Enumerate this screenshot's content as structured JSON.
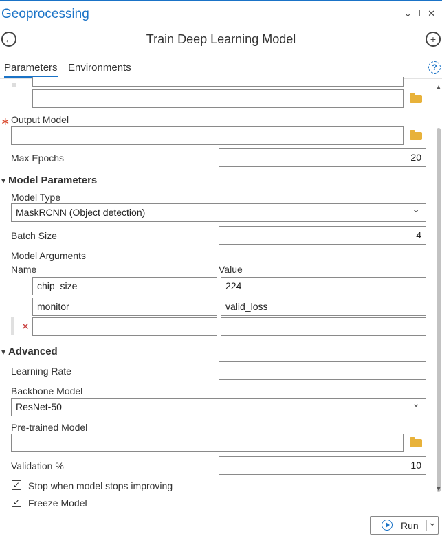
{
  "pane": {
    "title": "Geoprocessing",
    "header_icons": [
      "chevron-down-icon",
      "pin-icon",
      "close-icon"
    ],
    "accent_color": "#1a73c7"
  },
  "tool": {
    "title": "Train Deep Learning Model"
  },
  "tabs": [
    {
      "label": "Parameters",
      "active": true
    },
    {
      "label": "Environments",
      "active": false
    }
  ],
  "params": {
    "top_field_value": "",
    "output_model": {
      "label": "Output Model",
      "value": ""
    },
    "max_epochs": {
      "label": "Max Epochs",
      "value": "20"
    }
  },
  "model_params": {
    "section_label": "Model Parameters",
    "model_type": {
      "label": "Model Type",
      "value": "MaskRCNN (Object detection)"
    },
    "batch_size": {
      "label": "Batch Size",
      "value": "4"
    },
    "model_arguments": {
      "label": "Model Arguments",
      "col_name": "Name",
      "col_value": "Value",
      "rows": [
        {
          "name": "chip_size",
          "value": "224"
        },
        {
          "name": "monitor",
          "value": "valid_loss"
        },
        {
          "name": "",
          "value": ""
        }
      ]
    }
  },
  "advanced": {
    "section_label": "Advanced",
    "learning_rate": {
      "label": "Learning Rate",
      "value": ""
    },
    "backbone": {
      "label": "Backbone Model",
      "value": "ResNet-50"
    },
    "pretrained": {
      "label": "Pre-trained Model",
      "value": ""
    },
    "validation": {
      "label": "Validation %",
      "value": "10"
    },
    "stop_improving": {
      "label": "Stop when model stops improving",
      "checked": true
    },
    "freeze": {
      "label": "Freeze Model",
      "checked": true
    }
  },
  "run_button": {
    "label": "Run"
  }
}
